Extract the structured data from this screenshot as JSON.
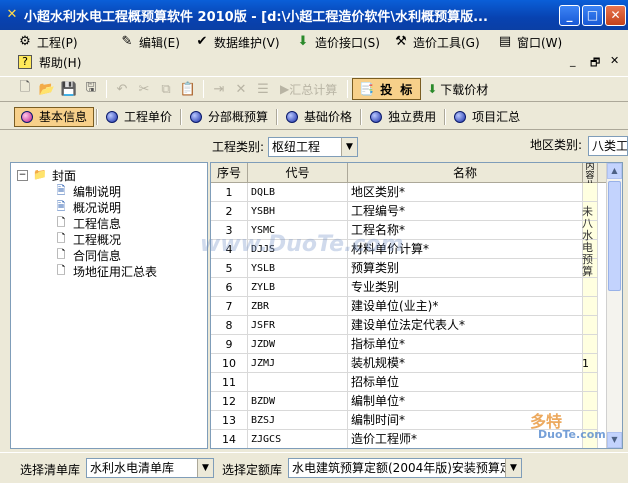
{
  "window": {
    "title": "小超水利水电工程概预算软件 2010版 - [d:\\小超工程造价软件\\水利概预算版...",
    "minimize": "_",
    "maximize": "□",
    "close": "✕"
  },
  "menu": {
    "items": [
      {
        "label": "工程(P)",
        "icon": "project-icon"
      },
      {
        "label": "编辑(E)",
        "icon": "edit-icon"
      },
      {
        "label": "数据维护(V)",
        "icon": "data-maintenance-icon"
      },
      {
        "label": "造价接口(S)",
        "icon": "interface-icon"
      },
      {
        "label": "造价工具(G)",
        "icon": "tools-icon"
      },
      {
        "label": "窗口(W)",
        "icon": "window-icon"
      }
    ],
    "help": "帮助(H)",
    "mdi_min": "_",
    "mdi_restore": "🗗",
    "mdi_close": "✕"
  },
  "toolbar": {
    "calc_label": "汇总计算",
    "bid_label": "投标",
    "download_label": "下载价材"
  },
  "tabs": [
    {
      "label": "基本信息",
      "active": true
    },
    {
      "label": "工程单价",
      "active": false
    },
    {
      "label": "分部概预算",
      "active": false
    },
    {
      "label": "基础价格",
      "active": false
    },
    {
      "label": "独立费用",
      "active": false
    },
    {
      "label": "项目汇总",
      "active": false
    }
  ],
  "filters": {
    "project_type_label": "工程类别:",
    "project_type_value": "枢纽工程",
    "region_label": "地区类别:",
    "region_value": "八类工"
  },
  "tree": {
    "root": "封面",
    "children": [
      "编制说明",
      "概况说明",
      "工程信息",
      "工程概况",
      "合同信息",
      "场地征用汇总表"
    ]
  },
  "grid": {
    "headers": [
      "序号",
      "代号",
      "名称"
    ],
    "rows": [
      [
        "1",
        "DQLB",
        "地区类别*"
      ],
      [
        "2",
        "YSBH",
        "工程编号*"
      ],
      [
        "3",
        "YSMC",
        "工程名称*"
      ],
      [
        "4",
        "DJJS",
        "材料单价计算*"
      ],
      [
        "5",
        "YSLB",
        "预算类别"
      ],
      [
        "6",
        "ZYLB",
        "专业类别"
      ],
      [
        "7",
        "ZBR",
        "建设单位(业主)*"
      ],
      [
        "8",
        "JSFR",
        "建设单位法定代表人*"
      ],
      [
        "9",
        "JZDW",
        "指标单位*"
      ],
      [
        "10",
        "JZMJ",
        "装机规模*"
      ],
      [
        "11",
        "",
        "招标单位"
      ],
      [
        "12",
        "BZDW",
        "编制单位*"
      ],
      [
        "13",
        "BZSJ",
        "编制时间*"
      ],
      [
        "14",
        "ZJGCS",
        "造价工程师*"
      ]
    ],
    "extra_col_header": "内容八类*",
    "extra_col_text": "未八水电预算",
    "extra_col_value": "1"
  },
  "statusbar": {
    "list_label": "选择清单库",
    "list_value": "水利水电清单库",
    "quota_label": "选择定额库",
    "quota_value": "水电建筑预算定额(2004年版)安装预算定"
  },
  "watermarks": {
    "main": "www.DuoTe.com",
    "logo": "多特",
    "logo_url": "DuoTe.com"
  }
}
